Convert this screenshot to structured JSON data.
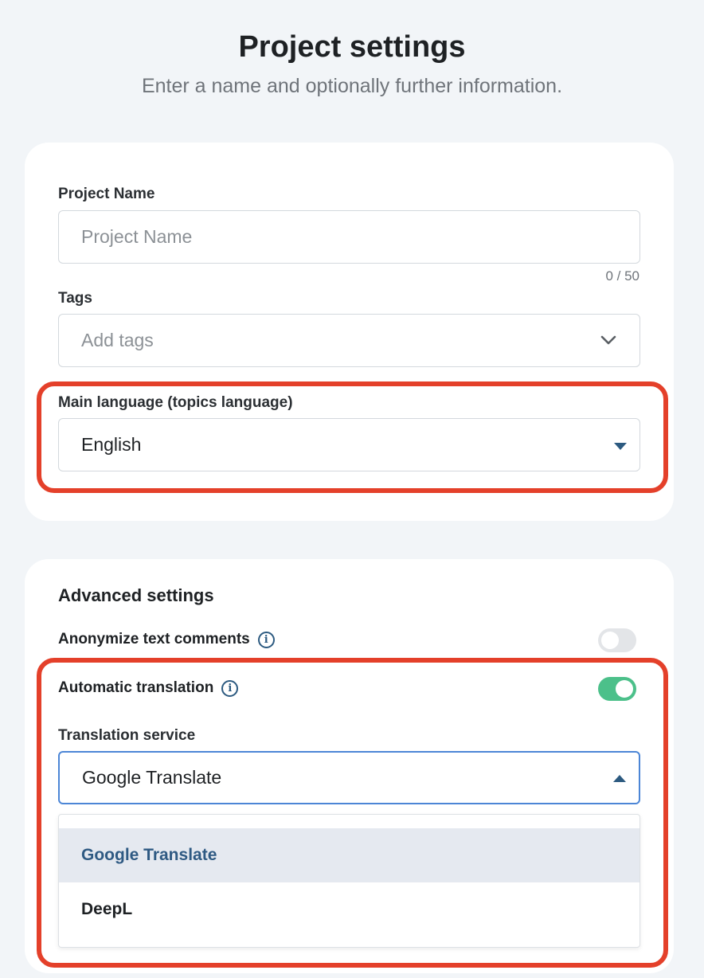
{
  "header": {
    "title": "Project settings",
    "subtitle": "Enter a name and optionally further information."
  },
  "project": {
    "name_label": "Project Name",
    "name_placeholder": "Project Name",
    "name_counter": "0 / 50",
    "tags_label": "Tags",
    "tags_placeholder": "Add tags",
    "language_label": "Main language (topics language)",
    "language_value": "English"
  },
  "advanced": {
    "title": "Advanced settings",
    "anonymize_label": "Anonymize text comments",
    "anonymize_enabled": false,
    "translation_label": "Automatic translation",
    "translation_enabled": true,
    "service_label": "Translation service",
    "service_value": "Google Translate",
    "service_options": [
      "Google Translate",
      "DeepL"
    ],
    "service_selected_index": 0
  },
  "colors": {
    "highlight": "#e4402a",
    "toggle_on": "#4cc08a",
    "accent": "#2c5a80"
  },
  "icons": {
    "info": "info-icon",
    "tags_dropdown": "chevron-down-icon",
    "language_dropdown": "caret-down-icon",
    "service_dropdown": "caret-up-icon"
  }
}
